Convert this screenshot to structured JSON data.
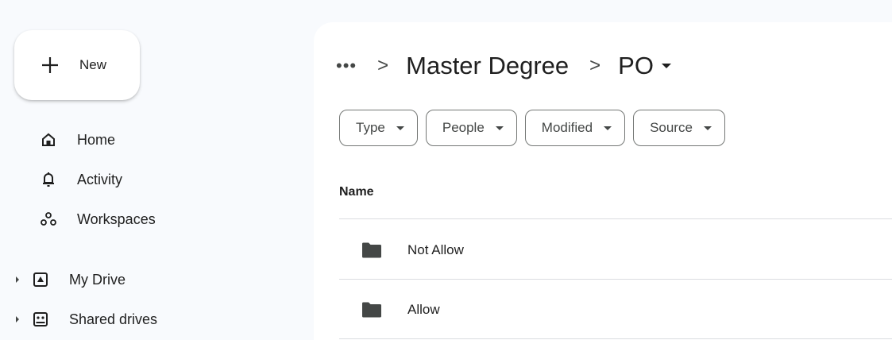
{
  "sidebar": {
    "new_label": "New",
    "items": [
      {
        "label": "Home",
        "icon": "home-icon"
      },
      {
        "label": "Activity",
        "icon": "bell-icon"
      },
      {
        "label": "Workspaces",
        "icon": "workspaces-icon"
      },
      {
        "label": "My Drive",
        "icon": "my-drive-icon"
      },
      {
        "label": "Shared drives",
        "icon": "shared-drives-icon"
      }
    ]
  },
  "breadcrumb": {
    "more": "•••",
    "separator": ">",
    "parent": "Master Degree",
    "current": "PO"
  },
  "filters": [
    {
      "label": "Type"
    },
    {
      "label": "People"
    },
    {
      "label": "Modified"
    },
    {
      "label": "Source"
    }
  ],
  "table": {
    "name_header": "Name",
    "rows": [
      {
        "name": "Not Allow",
        "icon": "folder-icon"
      },
      {
        "name": "Allow",
        "icon": "folder-icon"
      }
    ]
  },
  "colors": {
    "background": "#f8fafd",
    "surface": "#ffffff",
    "text": "#1f1f1f",
    "divider": "#dadce0"
  }
}
